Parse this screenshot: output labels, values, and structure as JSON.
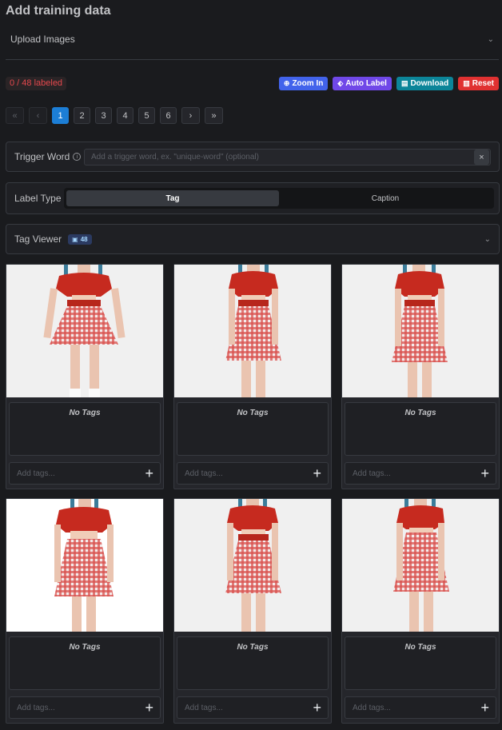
{
  "title": "Add training data",
  "upload": {
    "label": "Upload Images"
  },
  "status": {
    "labeled_text": "0 / 48 labeled"
  },
  "actions": {
    "zoom_in": "Zoom In",
    "auto_label": "Auto Label",
    "download": "Download",
    "reset": "Reset"
  },
  "pagination": {
    "first": "«",
    "prev": "‹",
    "pages": [
      "1",
      "2",
      "3",
      "4",
      "5",
      "6"
    ],
    "active_page": "1",
    "next": "›",
    "last": "»"
  },
  "trigger": {
    "label": "Trigger Word",
    "placeholder": "Add a trigger word, ex. \"unique-word\" (optional)",
    "value": "",
    "clear": "×"
  },
  "label_type": {
    "label": "Label Type",
    "options": [
      "Tag",
      "Caption"
    ],
    "selected": "Tag"
  },
  "tag_viewer": {
    "label": "Tag Viewer",
    "count": "48"
  },
  "cards": [
    {
      "no_tags": "No Tags",
      "add_placeholder": "Add tags..."
    },
    {
      "no_tags": "No Tags",
      "add_placeholder": "Add tags..."
    },
    {
      "no_tags": "No Tags",
      "add_placeholder": "Add tags..."
    },
    {
      "no_tags": "No Tags",
      "add_placeholder": "Add tags..."
    },
    {
      "no_tags": "No Tags",
      "add_placeholder": "Add tags..."
    },
    {
      "no_tags": "No Tags",
      "add_placeholder": "Add tags..."
    }
  ],
  "icons": {
    "chevron": "chevron-down-icon",
    "info": "info-icon",
    "zoom": "zoom-in-icon",
    "tag": "tag-icon",
    "download": "file-download-icon",
    "reset": "trash-icon",
    "add": "plus-icon"
  },
  "colors": {
    "background": "#1a1b1e",
    "accent": "#1c7ed6",
    "zoom": "#4263eb",
    "auto_label": "#7048e8",
    "download": "#0c8599",
    "reset": "#e03131",
    "labeled_text": "#e5484d"
  }
}
